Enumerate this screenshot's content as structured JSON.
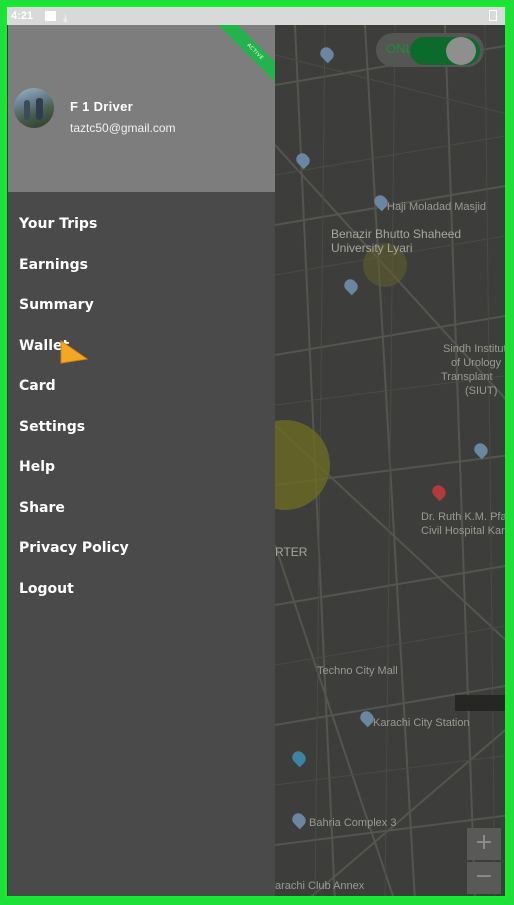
{
  "status_bar": {
    "time": "4:21",
    "download_glyph": "⤓"
  },
  "driver_toggle": {
    "label": "ONL",
    "state": "on"
  },
  "drawer": {
    "ribbon": "ACTIVE",
    "driver_name": "F 1  Driver",
    "driver_email": "taztc50@gmail.com",
    "menu": [
      {
        "label": "Your Trips"
      },
      {
        "label": "Earnings"
      },
      {
        "label": "Summary"
      },
      {
        "label": "Wallet"
      },
      {
        "label": "Card"
      },
      {
        "label": "Settings"
      },
      {
        "label": "Help"
      },
      {
        "label": "Share"
      },
      {
        "label": "Privacy Policy"
      },
      {
        "label": "Logout"
      }
    ]
  },
  "map": {
    "labels": {
      "haji": "Haji Moladad Masjid",
      "benazir1": "Benazir Bhutto Shaheed",
      "benazir2": "University Lyari",
      "smh1": "Sindh Institute",
      "smh2": "of Urology",
      "smh3": "Transplant",
      "smh4": "(SIUT)",
      "ruth1": "Dr. Ruth K.M. Pfau",
      "ruth2": "Civil Hospital Kar...",
      "quarter": "RTER",
      "techno": "Techno City Mall",
      "karachi": "Karachi City Station",
      "bahria": "Bahria Complex 3",
      "club": "arachi Club Annex"
    },
    "zoom_in": "+",
    "zoom_out": "−"
  },
  "colors": {
    "accent_green": "#23b24b",
    "drawer_bg": "#4a4a4a",
    "header_bg": "#7d7d7d"
  }
}
